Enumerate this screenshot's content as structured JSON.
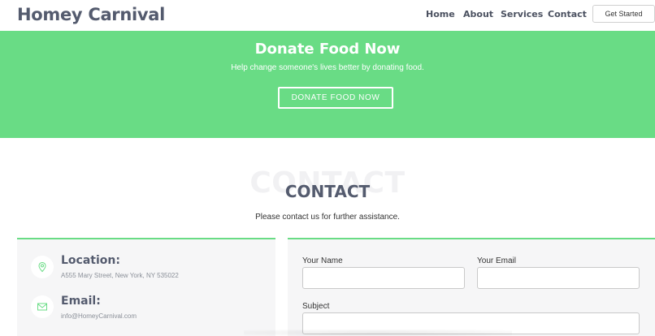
{
  "header": {
    "logo": "Homey Carnival",
    "nav": [
      "Home",
      "About",
      "Services",
      "Contact"
    ],
    "cta": "Get Started"
  },
  "hero": {
    "title": "Donate Food Now",
    "subtitle": "Help change someone's lives better by donating food.",
    "button": "DONATE FOOD NOW",
    "bg_color": "#69dc85"
  },
  "contact": {
    "bg_title": "CONTACT",
    "title": "CONTACT",
    "subtitle": "Please contact us for further assistance.",
    "info": [
      {
        "icon": "map-pin-icon",
        "label": "Location:",
        "value": "A555 Mary Street, New York, NY 535022"
      },
      {
        "icon": "envelope-icon",
        "label": "Email:",
        "value": "info@HomeyCarnival.com"
      }
    ],
    "form": {
      "name_label": "Your Name",
      "email_label": "Your Email",
      "subject_label": "Subject"
    },
    "accent": "#69dc85"
  }
}
